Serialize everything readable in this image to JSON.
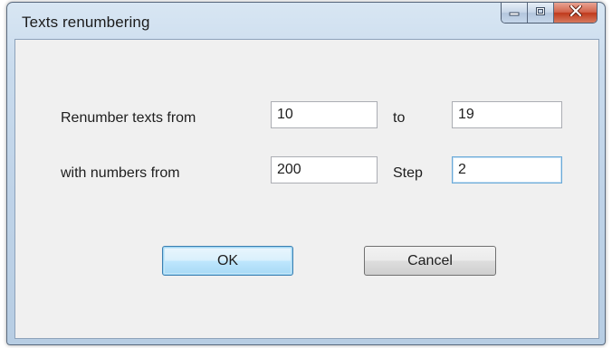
{
  "window": {
    "title": "Texts renumbering",
    "controls": {
      "minimize_icon": "minimize-icon",
      "maximize_icon": "maximize-icon",
      "close_icon": "close-icon"
    }
  },
  "form": {
    "row1": {
      "label": "Renumber texts from",
      "from_value": "10",
      "to_label": "to",
      "to_value": "19"
    },
    "row2": {
      "label": "with numbers from",
      "from_value": "200",
      "step_label": "Step",
      "step_value": "2"
    }
  },
  "buttons": {
    "ok_label": "OK",
    "cancel_label": "Cancel"
  },
  "colors": {
    "frame": "#bfd3e8",
    "client_background": "#f0f0f0",
    "close_button": "#c7452a",
    "default_button_border": "#3c7fb1"
  }
}
